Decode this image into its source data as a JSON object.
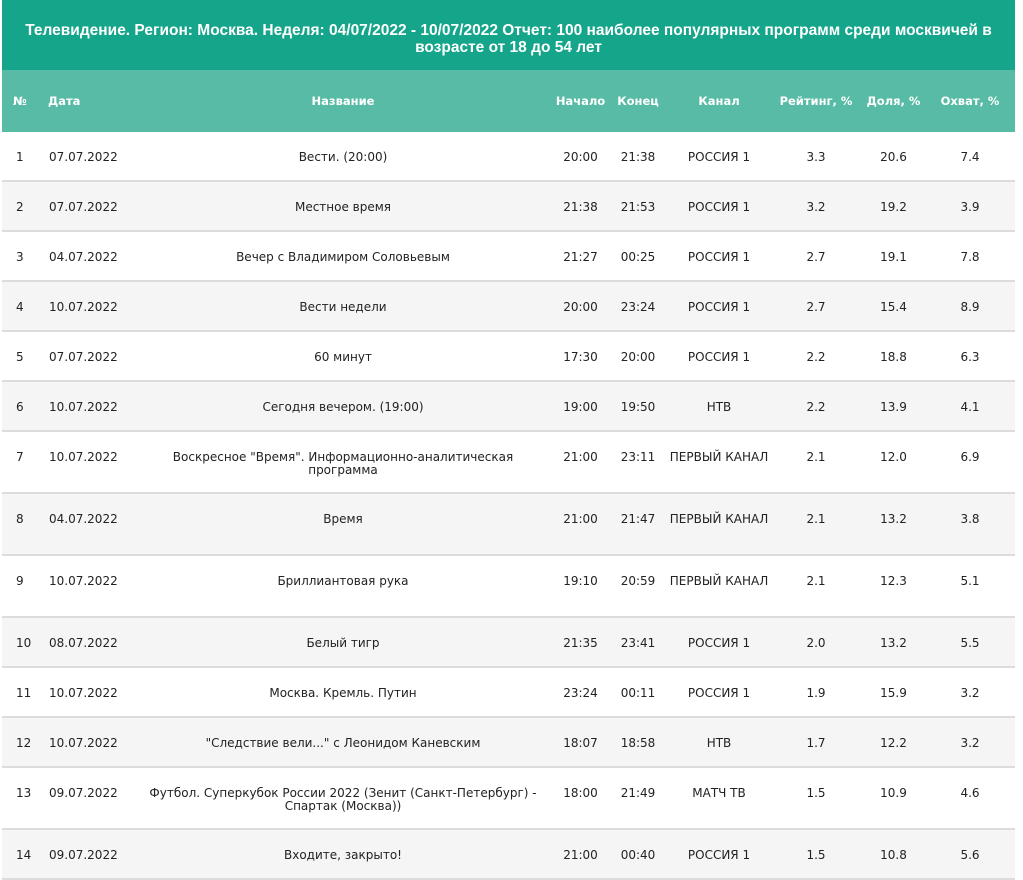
{
  "title": "Телевидение. Регион: Москва. Неделя: 04/07/2022 - 10/07/2022 Отчет: 100 наиболее популярных программ среди москвичей в возрасте от 18 до 54 лет",
  "headers": {
    "num": "№",
    "date": "Дата",
    "name": "Название",
    "start": "Начало",
    "end": "Конец",
    "channel": "Канал",
    "rating": "Рейтинг, %",
    "share": "Доля, %",
    "reach": "Охват, %"
  },
  "rows": [
    {
      "num": "1",
      "date": "07.07.2022",
      "name": "Вести. (20:00)",
      "start": "20:00",
      "end": "21:38",
      "channel": "РОССИЯ 1",
      "rating": "3.3",
      "share": "20.6",
      "reach": "7.4"
    },
    {
      "num": "2",
      "date": "07.07.2022",
      "name": "Местное время",
      "start": "21:38",
      "end": "21:53",
      "channel": "РОССИЯ 1",
      "rating": "3.2",
      "share": "19.2",
      "reach": "3.9"
    },
    {
      "num": "3",
      "date": "04.07.2022",
      "name": "Вечер с Владимиром Соловьевым",
      "start": "21:27",
      "end": "00:25",
      "channel": "РОССИЯ 1",
      "rating": "2.7",
      "share": "19.1",
      "reach": "7.8"
    },
    {
      "num": "4",
      "date": "10.07.2022",
      "name": "Вести недели",
      "start": "20:00",
      "end": "23:24",
      "channel": "РОССИЯ 1",
      "rating": "2.7",
      "share": "15.4",
      "reach": "8.9"
    },
    {
      "num": "5",
      "date": "07.07.2022",
      "name": "60 минут",
      "start": "17:30",
      "end": "20:00",
      "channel": "РОССИЯ 1",
      "rating": "2.2",
      "share": "18.8",
      "reach": "6.3"
    },
    {
      "num": "6",
      "date": "10.07.2022",
      "name": "Сегодня вечером. (19:00)",
      "start": "19:00",
      "end": "19:50",
      "channel": "НТВ",
      "rating": "2.2",
      "share": "13.9",
      "reach": "4.1"
    },
    {
      "num": "7",
      "date": "10.07.2022",
      "name": "Воскресное \"Время\". Информационно-аналитическая программа",
      "start": "21:00",
      "end": "23:11",
      "channel": "ПЕРВЫЙ КАНАЛ",
      "rating": "2.1",
      "share": "12.0",
      "reach": "6.9"
    },
    {
      "num": "8",
      "date": "04.07.2022",
      "name": "Время",
      "start": "21:00",
      "end": "21:47",
      "channel": "ПЕРВЫЙ КАНАЛ",
      "rating": "2.1",
      "share": "13.2",
      "reach": "3.8"
    },
    {
      "num": "9",
      "date": "10.07.2022",
      "name": "Бриллиантовая рука",
      "start": "19:10",
      "end": "20:59",
      "channel": "ПЕРВЫЙ КАНАЛ",
      "rating": "2.1",
      "share": "12.3",
      "reach": "5.1"
    },
    {
      "num": "10",
      "date": "08.07.2022",
      "name": "Белый тигр",
      "start": "21:35",
      "end": "23:41",
      "channel": "РОССИЯ 1",
      "rating": "2.0",
      "share": "13.2",
      "reach": "5.5"
    },
    {
      "num": "11",
      "date": "10.07.2022",
      "name": "Москва. Кремль. Путин",
      "start": "23:24",
      "end": "00:11",
      "channel": "РОССИЯ 1",
      "rating": "1.9",
      "share": "15.9",
      "reach": "3.2"
    },
    {
      "num": "12",
      "date": "10.07.2022",
      "name": "\"Следствие вели...\" с Леонидом Каневским",
      "start": "18:07",
      "end": "18:58",
      "channel": "НТВ",
      "rating": "1.7",
      "share": "12.2",
      "reach": "3.2"
    },
    {
      "num": "13",
      "date": "09.07.2022",
      "name": "Футбол. Суперкубок России 2022 (Зенит (Санкт-Петербург) - Спартак (Москва))",
      "start": "18:00",
      "end": "21:49",
      "channel": "МАТЧ ТВ",
      "rating": "1.5",
      "share": "10.9",
      "reach": "4.6"
    },
    {
      "num": "14",
      "date": "09.07.2022",
      "name": "Входите, закрыто!",
      "start": "21:00",
      "end": "00:40",
      "channel": "РОССИЯ 1",
      "rating": "1.5",
      "share": "10.8",
      "reach": "5.6"
    }
  ]
}
